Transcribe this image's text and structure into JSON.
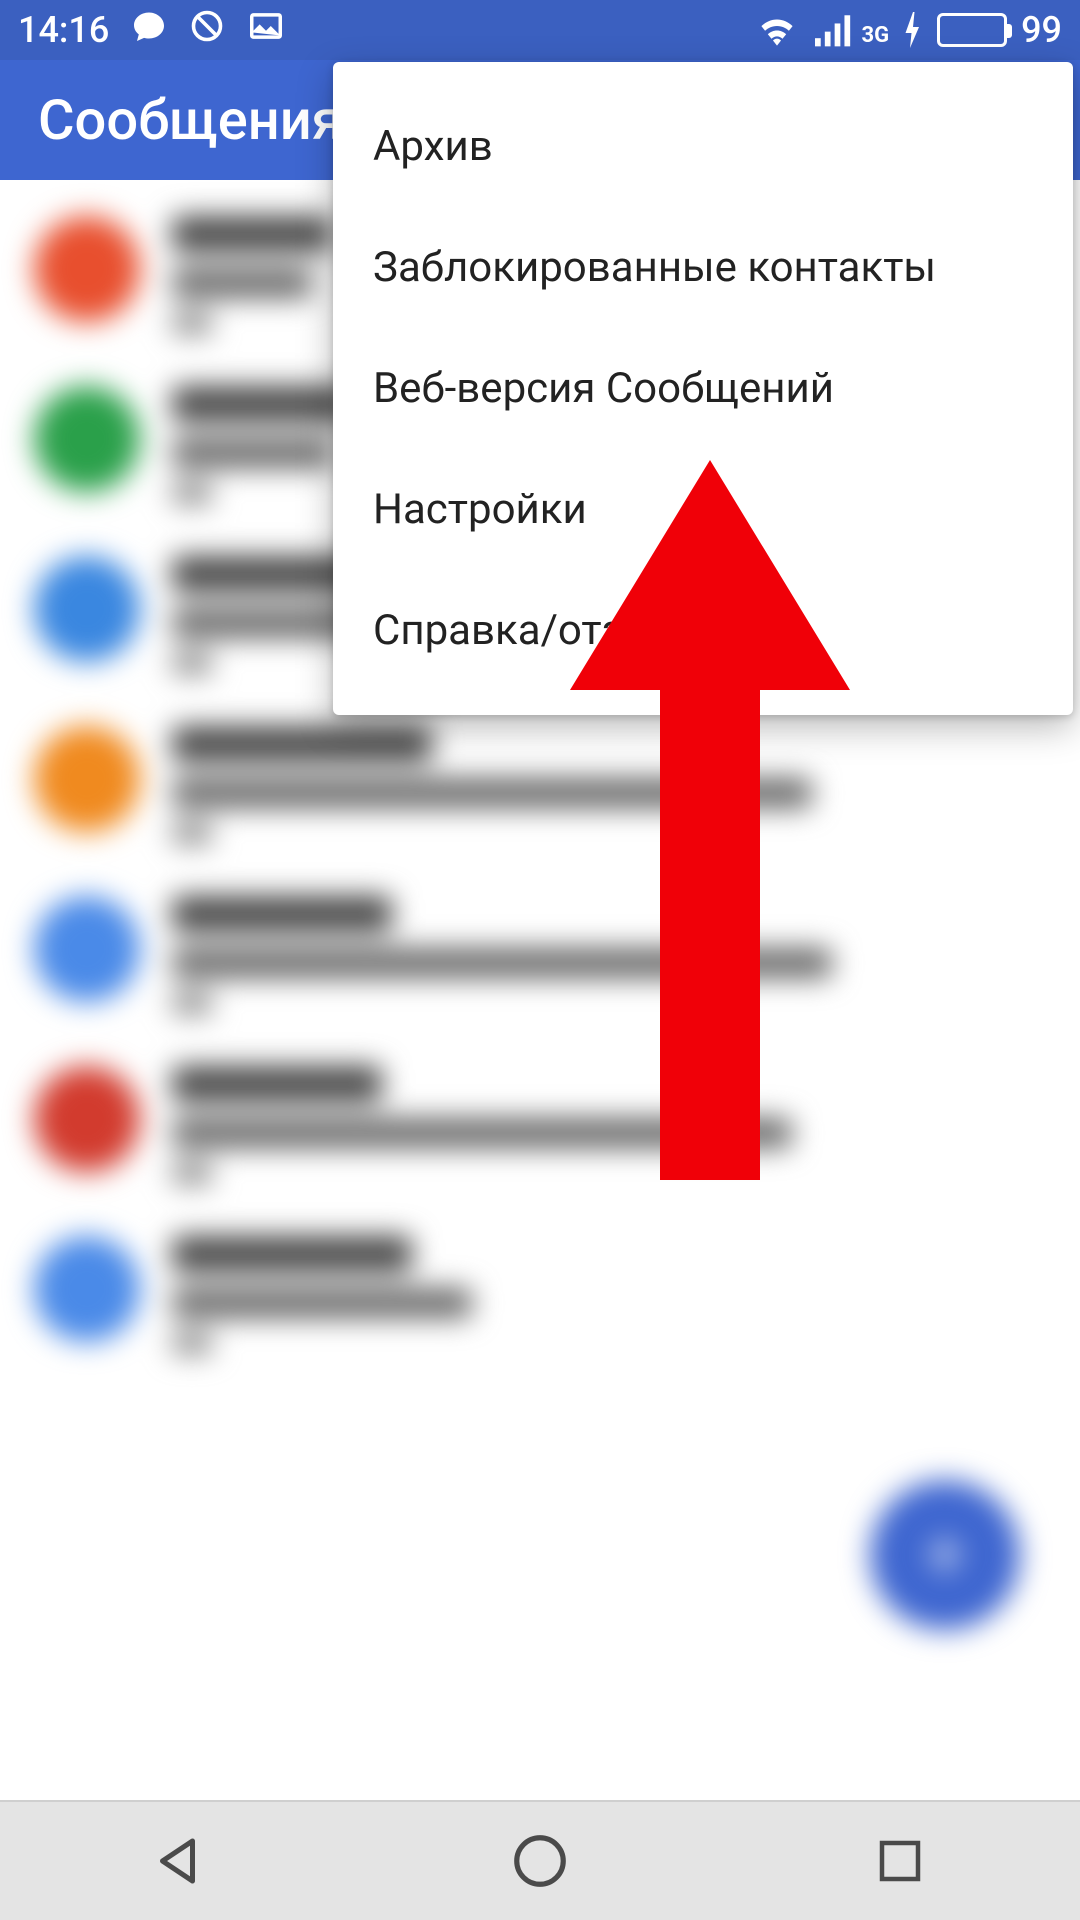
{
  "status": {
    "time": "14:16",
    "network_label": "3G",
    "battery_percent": "99"
  },
  "appbar": {
    "title": "Сообщения"
  },
  "menu": {
    "items": [
      {
        "label": "Архив"
      },
      {
        "label": "Заблокированные контакты"
      },
      {
        "label": "Веб-версия Сообщений"
      },
      {
        "label": "Настройки"
      },
      {
        "label": "Справка/отзыв"
      }
    ]
  },
  "conversations": [
    {
      "avatar_color": "#e84f2e",
      "w1": 160,
      "w2": 140
    },
    {
      "avatar_color": "#2aa04a",
      "w1": 180,
      "w2": 160
    },
    {
      "avatar_color": "#3a87e0",
      "w1": 320,
      "w2": 420
    },
    {
      "avatar_color": "#f08a1f",
      "w1": 260,
      "w2": 640
    },
    {
      "avatar_color": "#4a8ae8",
      "w1": 220,
      "w2": 660
    },
    {
      "avatar_color": "#d23b2e",
      "w1": 210,
      "w2": 620
    },
    {
      "avatar_color": "#4a8ae8",
      "w1": 240,
      "w2": 300
    }
  ],
  "annotation": {
    "arrow_color": "#f00008"
  }
}
